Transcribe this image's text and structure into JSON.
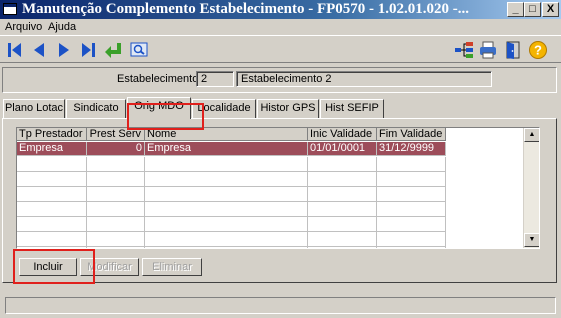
{
  "window": {
    "title": "Manutenção Complemento Estabelecimento - FP0570 - 1.02.01.020 -...",
    "minimize": "_",
    "maximize": "□",
    "close": "X"
  },
  "menu": [
    "Arquivo",
    "Ajuda"
  ],
  "toolbar": {
    "nav_icons": [
      "first-record-icon",
      "previous-record-icon",
      "next-record-icon",
      "last-record-icon",
      "go-to-icon",
      "zoom-search-icon"
    ],
    "right_icons": [
      "hierarchy-icon",
      "printer-icon",
      "exit-icon",
      "help-icon"
    ]
  },
  "estabelecimento": {
    "label": "Estabelecimento:",
    "code": "2",
    "name": "Estabelecimento 2"
  },
  "tabs": [
    "Plano Lotac",
    "Sindicato",
    "Orig MDO",
    "Localidade",
    "Histor GPS",
    "Hist SEFIP"
  ],
  "active_tab": "Orig MDO",
  "grid": {
    "columns": [
      "Tp Prestador",
      "Prest Serv",
      "Nome",
      "Inic Validade",
      "Fim Validade"
    ],
    "rows": [
      {
        "tp_prestador": "Empresa",
        "prest_serv": "0",
        "nome": "Empresa",
        "inic_validade": "01/01/0001",
        "fim_validade": "31/12/9999"
      }
    ]
  },
  "buttons": {
    "incluir": "Incluir",
    "modificar": "Modificar",
    "eliminar": "Eliminar"
  },
  "colors": {
    "selected_row": "#9d4d5a",
    "highlight_box": "#e0201c",
    "title_bar": "#0a246a"
  }
}
